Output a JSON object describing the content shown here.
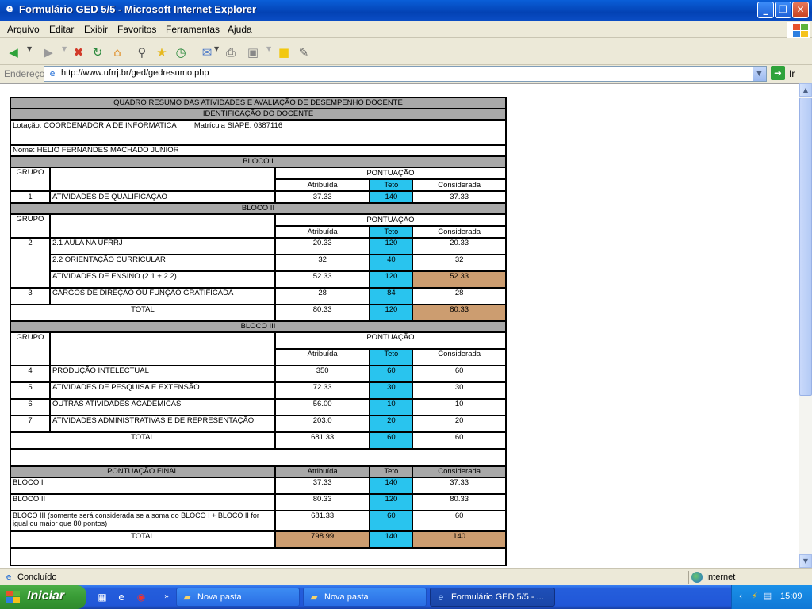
{
  "window": {
    "title": "Formulário GED 5/5 - Microsoft Internet Explorer"
  },
  "menu": [
    "Arquivo",
    "Editar",
    "Exibir",
    "Favoritos",
    "Ferramentas",
    "Ajuda"
  ],
  "address": {
    "label": "Endereço",
    "url": "http://www.ufrrj.br/ged/gedresumo.php",
    "go_label": "Ir"
  },
  "form": {
    "main_title": "QUADRO RESUMO DAS ATIVIDADES E AVALIAÇÃO DE DESEMPENHO DOCENTE",
    "identification_title": "IDENTIFICAÇÃO DO DOCENTE",
    "lotacao": "Lotação: COORDENADORIA DE INFORMATICA",
    "matricula": "Matrícula SIAPE: 0387116",
    "nome": "Nome: HELIO FERNANDES MACHADO JUNIOR",
    "col_grupo": "GRUPO",
    "col_pontuacao": "PONTUAÇÃO",
    "col_atribuida": "Atribuída",
    "col_teto": "Teto",
    "col_considerada": "Considerada",
    "total_label": "TOTAL",
    "bloco1": {
      "title": "BLOCO I",
      "rows": [
        {
          "grupo": "1",
          "desc": "ATIVIDADES DE QUALIFICAÇÃO",
          "atribuida": "37.33",
          "teto": "140",
          "considerada": "37.33"
        }
      ]
    },
    "bloco2": {
      "title": "BLOCO II",
      "rows": [
        {
          "grupo": "2",
          "desc": "2.1 AULA NA UFRRJ",
          "atribuida": "20.33",
          "teto": "120",
          "considerada": "20.33"
        },
        {
          "grupo": "",
          "desc": "2.2 ORIENTAÇÃO CURRICULAR",
          "atribuida": "32",
          "teto": "40",
          "considerada": "32"
        },
        {
          "grupo": "",
          "desc": "ATIVIDADES DE ENSINO (2.1 + 2.2)",
          "atribuida": "52.33",
          "teto": "120",
          "considerada": "52.33"
        },
        {
          "grupo": "3",
          "desc": "CARGOS DE DIREÇÃO OU FUNÇÃO GRATIFICADA",
          "atribuida": "28",
          "teto": "84",
          "considerada": "28"
        }
      ],
      "total": {
        "atribuida": "80.33",
        "teto": "120",
        "considerada": "80.33"
      }
    },
    "bloco3": {
      "title": "BLOCO III",
      "rows": [
        {
          "grupo": "4",
          "desc": "PRODUÇÃO INTELECTUAL",
          "atribuida": "350",
          "teto": "60",
          "considerada": "60"
        },
        {
          "grupo": "5",
          "desc": "ATIVIDADES DE PESQUISA E EXTENSÃO",
          "atribuida": "72.33",
          "teto": "30",
          "considerada": "30"
        },
        {
          "grupo": "6",
          "desc": "OUTRAS ATIVIDADES ACADÊMICAS",
          "atribuida": "56.00",
          "teto": "10",
          "considerada": "10"
        },
        {
          "grupo": "7",
          "desc": "ATIVIDADES ADMINISTRATIVAS E DE REPRESENTAÇÃO",
          "atribuida": "203.0",
          "teto": "20",
          "considerada": "20"
        }
      ],
      "total": {
        "atribuida": "681.33",
        "teto": "60",
        "considerada": "60"
      }
    },
    "final": {
      "title": "PONTUAÇÃO FINAL",
      "rows": [
        {
          "label": "BLOCO I",
          "atribuida": "37.33",
          "teto": "140",
          "considerada": "37.33"
        },
        {
          "label": "BLOCO II",
          "atribuida": "80.33",
          "teto": "120",
          "considerada": "80.33"
        },
        {
          "label": "BLOCO III (somente será considerada se a soma do BLOCO I + BLOCO II for igual ou maior que 80 pontos)",
          "atribuida": "681.33",
          "teto": "60",
          "considerada": "60"
        }
      ],
      "total": {
        "atribuida": "798.99",
        "teto": "140",
        "considerada": "140"
      }
    }
  },
  "status": {
    "text": "Concluído",
    "zone": "Internet"
  },
  "taskbar": {
    "start": "Iniciar",
    "tasks": [
      "Nova pasta",
      "Nova pasta",
      "Formulário GED 5/5 - ..."
    ],
    "clock": "15:09"
  },
  "colors": {
    "teto": "#29C4EE",
    "highlight": "#CC9D70",
    "header": "#A8A8A8"
  }
}
